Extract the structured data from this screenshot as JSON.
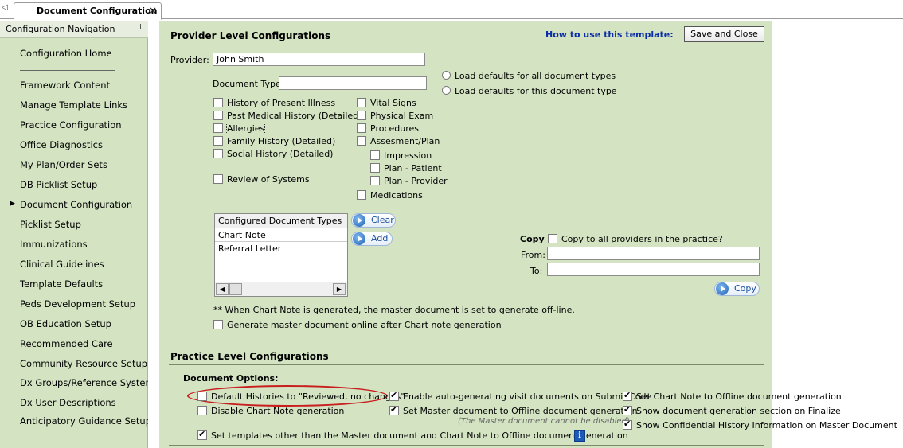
{
  "tabs": {
    "active_tab": "Document Configuration",
    "close_glyph": "×",
    "scroll_glyph": "◁"
  },
  "nav": {
    "title": "Configuration Navigation",
    "pin_glyph": "⊥",
    "items": [
      {
        "label": "Configuration Home"
      },
      {
        "label": "Framework Content"
      },
      {
        "label": "Manage Template Links"
      },
      {
        "label": "Practice Configuration"
      },
      {
        "label": "Office Diagnostics"
      },
      {
        "label": "My Plan/Order Sets"
      },
      {
        "label": "DB Picklist Setup"
      },
      {
        "label": "Document Configuration"
      },
      {
        "label": "Picklist Setup"
      },
      {
        "label": "Immunizations"
      },
      {
        "label": "Clinical Guidelines"
      },
      {
        "label": "Template Defaults"
      },
      {
        "label": "Peds Development Setup"
      },
      {
        "label": "OB Education Setup"
      },
      {
        "label": "Recommended Care"
      },
      {
        "label": "Community Resource Setup"
      },
      {
        "label": "Dx Groups/Reference Systems"
      },
      {
        "label": "Dx User Descriptions"
      },
      {
        "label": "Anticipatory Guidance Setup"
      }
    ],
    "selected_arrow": "▶"
  },
  "provider_section": {
    "title": "Provider Level Configurations",
    "howto_link": "How to use this template:",
    "save_close_label": "Save and Close",
    "provider_label": "Provider:",
    "provider_value": "John Smith",
    "doc_type_label": "Document Type:",
    "doc_type_value": "",
    "radio_all": "Load defaults for all document types",
    "radio_this": "Load defaults for this document type",
    "sections_left": [
      {
        "label": "History of Present Illness",
        "checked": false
      },
      {
        "label": "Past Medical History (Detailed)",
        "checked": false
      },
      {
        "label": "Allergies",
        "checked": false
      },
      {
        "label": "Family History (Detailed)",
        "checked": false
      },
      {
        "label": "Social History (Detailed)",
        "checked": false
      },
      {
        "label": "Review of Systems",
        "checked": false
      }
    ],
    "sections_right": [
      {
        "label": "Vital Signs",
        "checked": false
      },
      {
        "label": "Physical Exam",
        "checked": false
      },
      {
        "label": "Procedures",
        "checked": false
      },
      {
        "label": "Assesment/Plan",
        "checked": false
      },
      {
        "label": "Impression",
        "checked": false
      },
      {
        "label": "Plan - Patient",
        "checked": false
      },
      {
        "label": "Plan - Provider",
        "checked": false
      },
      {
        "label": "Medications",
        "checked": false
      }
    ],
    "configured_header": "Configured Document Types",
    "configured_rows": [
      "Chart Note",
      "Referral Letter"
    ],
    "clear_label": "Clear",
    "add_label": "Add",
    "copy_label": "Copy",
    "copy_all_label": "Copy to all providers in the practice?",
    "from_label": "From:",
    "to_label": "To:",
    "from_value": "",
    "to_value": "",
    "copy_button_label": "Copy",
    "note": "** When Chart Note is generated, the master document is set to generate off-line.",
    "generate_online_label": "Generate master document online after Chart note generation"
  },
  "practice_section": {
    "title": "Practice Level Configurations",
    "doc_options_label": "Document Options:",
    "options": {
      "default_histories": {
        "label": "Default Histories to \"Reviewed, no changes\"",
        "checked": false
      },
      "disable_chart_note": {
        "label": "Disable Chart Note generation",
        "checked": false
      },
      "enable_autogen": {
        "label": "Enable auto-generating visit documents on Submit Code",
        "checked": true
      },
      "set_master_offline": {
        "label": "Set Master document to Offline document generation",
        "checked": true
      },
      "master_note": "(The Master document cannot be disabled)",
      "set_chartnote_offline": {
        "label": "Set Chart Note to Offline document generation",
        "checked": true
      },
      "show_docgen_section": {
        "label": "Show document generation section on Finalize",
        "checked": true
      },
      "show_confidential": {
        "label": "Show Confidential History Information on Master Document",
        "checked": true
      },
      "set_templates_offline": {
        "label": "Set templates other than the Master document and Chart Note to Offline document generation",
        "checked": true
      }
    },
    "info_glyph": "i"
  }
}
